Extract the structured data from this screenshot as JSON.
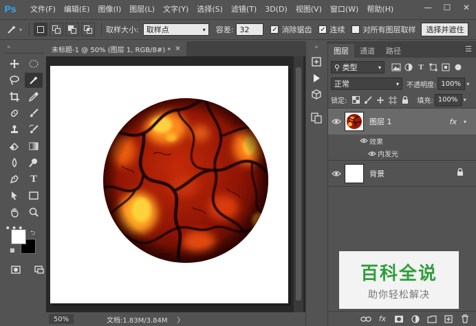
{
  "app": {
    "logo": "Ps"
  },
  "menu": [
    "文件(F)",
    "编辑(E)",
    "图像(I)",
    "图层(L)",
    "文字(Y)",
    "选择(S)",
    "滤镜(T)",
    "3D(D)",
    "视图(V)",
    "窗口(W)",
    "帮助(H)"
  ],
  "window_controls": [
    "—",
    "☐",
    "✕"
  ],
  "options": {
    "sample_size_label": "取样大小:",
    "sample_size_value": "取样点",
    "tolerance_label": "容差:",
    "tolerance_value": "32",
    "anti_alias_label": "消除锯齿",
    "contiguous_label": "连续",
    "sample_all_label": "对所有图层取样",
    "refine_label": "选择并遮住",
    "anti_alias_checked": true,
    "contiguous_checked": true,
    "sample_all_checked": false
  },
  "document": {
    "tab_title": "未标题-1 @ 50% (图层 1, RGB/8#) *",
    "zoom": "50%",
    "doc_info": "文档:1.83M/3.84M",
    "status_arrow": "〉"
  },
  "layers_panel": {
    "tabs": [
      "图层",
      "通道",
      "路径"
    ],
    "filter_kind": "类型",
    "blend_mode": "正常",
    "opacity_label": "不透明度:",
    "opacity_value": "100%",
    "lock_label": "锁定:",
    "fill_label": "填充:",
    "fill_value": "100%",
    "layers": [
      {
        "name": "图层 1",
        "fx": "fx",
        "effects_label": "效果",
        "effect": "内发光"
      },
      {
        "name": "背景"
      }
    ]
  },
  "watermark": {
    "title": "百科全说",
    "subtitle": "助你轻松解决"
  },
  "colors": {
    "foreground": "#ffffff",
    "background": "#000000",
    "ps_blue": "#31a8ff",
    "watermark_green": "#2e9e3b"
  }
}
